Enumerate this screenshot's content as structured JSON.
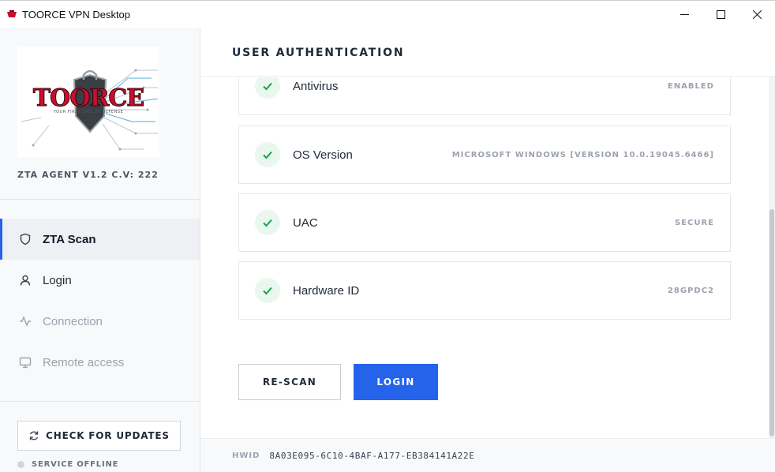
{
  "window": {
    "title": "TOORCE VPN Desktop",
    "controls": [
      "minimize-icon",
      "maximize-icon",
      "close-icon"
    ]
  },
  "sidebar": {
    "logo": {
      "brand": "TOORCE",
      "tagline": "YOUR FIRST LINE OF DEFENSE"
    },
    "version": "ZTA AGENT V1.2 C.V: 222",
    "items": [
      {
        "label": "ZTA Scan",
        "icon": "shield-icon",
        "state": "active"
      },
      {
        "label": "Login",
        "icon": "user-icon",
        "state": "normal"
      },
      {
        "label": "Connection",
        "icon": "activity-icon",
        "state": "disabled"
      },
      {
        "label": "Remote access",
        "icon": "monitor-icon",
        "state": "disabled"
      }
    ],
    "update_button": "CHECK FOR UPDATES",
    "service_status": "SERVICE OFFLINE"
  },
  "main": {
    "title": "USER AUTHENTICATION",
    "checks": [
      {
        "label": "Antivirus",
        "value": "ENABLED"
      },
      {
        "label": "OS Version",
        "value": "MICROSOFT WINDOWS [VERSION 10.0.19045.6466]"
      },
      {
        "label": "UAC",
        "value": "SECURE"
      },
      {
        "label": "Hardware ID",
        "value": "28GPDC2"
      }
    ],
    "rescan_button": "RE-SCAN",
    "login_button": "LOGIN"
  },
  "footer": {
    "hwid_label": "HWID",
    "hwid_value": "8A03E095-6C10-4BAF-A177-EB384141A22E"
  },
  "colors": {
    "accent": "#2563eb",
    "success": "#16a34a",
    "logo_red": "#c8102e"
  }
}
